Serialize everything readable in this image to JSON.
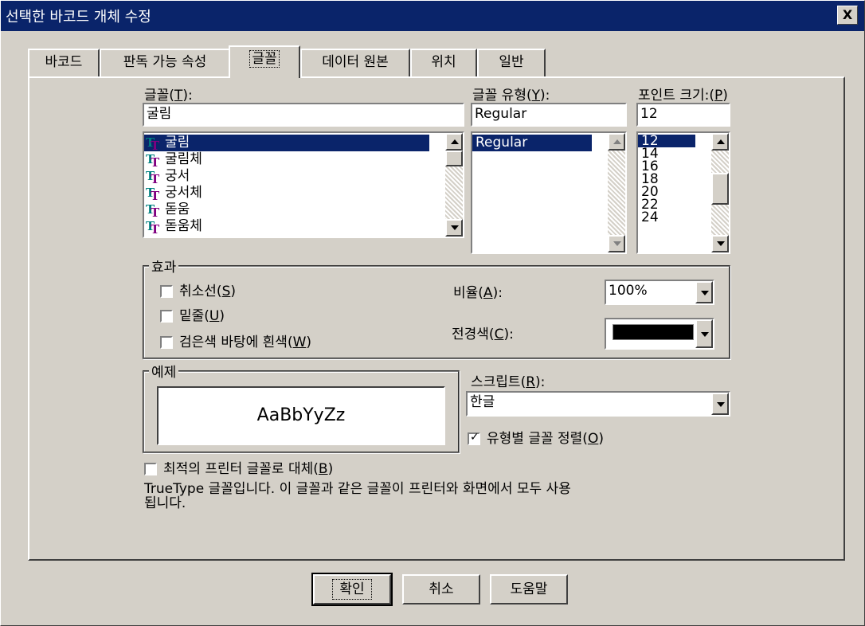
{
  "window": {
    "title": "선택한 바코드 개체 수정",
    "close_label": "X"
  },
  "tabs": [
    {
      "label": "바코드"
    },
    {
      "label": "판독 가능 속성"
    },
    {
      "label": "글꼴"
    },
    {
      "label": "데이터 원본"
    },
    {
      "label": "위치"
    },
    {
      "label": "일반"
    }
  ],
  "font": {
    "label": "글꼴",
    "hotkey": "T",
    "value": "굴림",
    "list": [
      "굴림",
      "굴림체",
      "궁서",
      "궁서체",
      "돋움",
      "돋움체"
    ],
    "selected": "굴림"
  },
  "style": {
    "label": "글꼴 유형",
    "hotkey": "Y",
    "value": "Regular",
    "list": [
      "Regular"
    ],
    "selected": "Regular"
  },
  "size": {
    "label": "포인트 크기:",
    "hotkey": "P",
    "value": "12",
    "list": [
      "12",
      "14",
      "16",
      "18",
      "20",
      "22",
      "24"
    ],
    "selected": "12"
  },
  "effects": {
    "title": "효과",
    "strikeout": {
      "label": "취소선",
      "hotkey": "S",
      "checked": false
    },
    "underline": {
      "label": "밑줄",
      "hotkey": "U",
      "checked": false
    },
    "reverse": {
      "label": "검은색 바탕에 흰색",
      "hotkey": "W",
      "checked": false
    },
    "ratio_label": "비율",
    "ratio_hotkey": "A",
    "ratio_value": "100%",
    "fg_label": "전경색",
    "fg_hotkey": "C",
    "fg_color": "#000000"
  },
  "sample": {
    "title": "예제",
    "text": "AaBbYyZz"
  },
  "script": {
    "label": "스크립트",
    "hotkey": "R",
    "value": "한글"
  },
  "sort_by_type": {
    "label": "유형별 글꼴 정렬",
    "hotkey": "O",
    "checked": true
  },
  "substitute": {
    "label": "최적의 프린터 글꼴로 대체",
    "hotkey": "B",
    "checked": false
  },
  "description": {
    "line1": "TrueType 글꼴입니다. 이 글꼴과 같은 글꼴이 프린터와 화면에서 모두 사용",
    "line2": "됩니다."
  },
  "buttons": {
    "ok": "확인",
    "cancel": "취소",
    "help": "도움말"
  },
  "colors": {
    "titlebar": "#0a246a",
    "dialog": "#d4d0c8",
    "selection": "#0a246a"
  }
}
